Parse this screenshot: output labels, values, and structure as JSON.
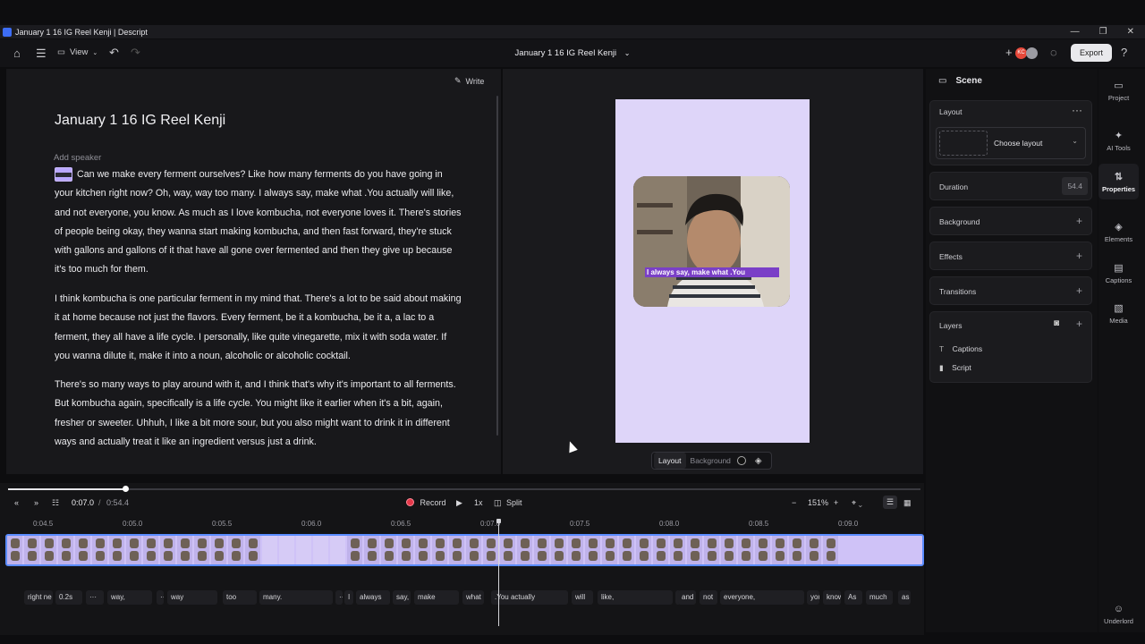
{
  "window": {
    "title": "January 1 16 IG Reel Kenji | Descript",
    "controls": [
      "—",
      "❐",
      "✕"
    ]
  },
  "toolbar": {
    "view_label": "View",
    "doc_title": "January 1 16 IG Reel Kenji",
    "export_label": "Export",
    "avatar_initials": "KC"
  },
  "editor": {
    "write_label": "Write",
    "title": "January 1 16 IG Reel Kenji",
    "add_speaker": "Add speaker",
    "paragraphs": [
      "Can we make every ferment ourselves? Like how many ferments do you have going in your kitchen right now? Oh, way, way too many. I always say, make what .You actually will like, and not everyone, you know. As much as I love kombucha, not everyone loves it. There's stories of people being okay, they wanna start making kombucha, and then fast forward, they're stuck with gallons and gallons of it that have all gone over fermented and then they give up because it's too much for them.",
      "I think kombucha is one particular ferment in my mind that. There's a lot to be said about making it at home because not just the flavors. Every ferment, be it a kombucha, be it a, a lac to a ferment, they all have a life cycle. I personally, like quite vinegarette, mix it with soda water. If you wanna dilute it, make it into a noun, alcoholic or alcoholic cocktail.",
      "There's so many ways to play around with it, and I think that's why it's important to all ferments. But kombucha again, specifically is a life cycle. You might like it earlier when it's a bit, again, fresher or sweeter. Uhhuh, I like a bit more sour, but you also might want to drink it in different ways and actually treat it like an ingredient versus just a drink."
    ]
  },
  "preview": {
    "caption_text": "I always say, make what .You",
    "tab_layout": "Layout",
    "tab_background": "Background"
  },
  "properties": {
    "header": "Scene",
    "layout_label": "Layout",
    "choose_layout": "Choose layout",
    "duration_label": "Duration",
    "duration_value": "54.4",
    "background_label": "Background",
    "effects_label": "Effects",
    "transitions_label": "Transitions",
    "layers_label": "Layers",
    "layers": [
      {
        "name": "Captions",
        "icon": "T"
      },
      {
        "name": "Script",
        "icon": "▮"
      }
    ]
  },
  "rail": [
    {
      "label": "Project",
      "icon": "▭"
    },
    {
      "label": "AI Tools",
      "icon": "✦"
    },
    {
      "label": "Properties",
      "icon": "⇅"
    },
    {
      "label": "Elements",
      "icon": "◈"
    },
    {
      "label": "Captions",
      "icon": "▤"
    },
    {
      "label": "Media",
      "icon": "▧"
    },
    {
      "label": "Underlord",
      "icon": "☺"
    }
  ],
  "timeline": {
    "current_time": "0:07.0",
    "separator": "/",
    "total_time": "0:54.4",
    "record_label": "Record",
    "speed_label": "1x",
    "split_label": "Split",
    "zoom_label": "151%",
    "playback_progress": 0.128,
    "ruler_ticks": [
      "0:04.5",
      "0:05.0",
      "0:05.5",
      "0:06.0",
      "0:06.5",
      "0:07.0",
      "0:07.5",
      "0:08.0",
      "0:08.5",
      "0:09.0"
    ],
    "words": [
      "right ne",
      "0.2s",
      "···",
      "way,",
      "···",
      "way",
      "too",
      "many.",
      "···",
      "I",
      "always",
      "say,",
      "make",
      "what",
      ".You actually",
      "will",
      "like,",
      "···",
      "and",
      "not",
      "everyone,",
      "you",
      "know",
      "As",
      "much",
      "as"
    ]
  }
}
